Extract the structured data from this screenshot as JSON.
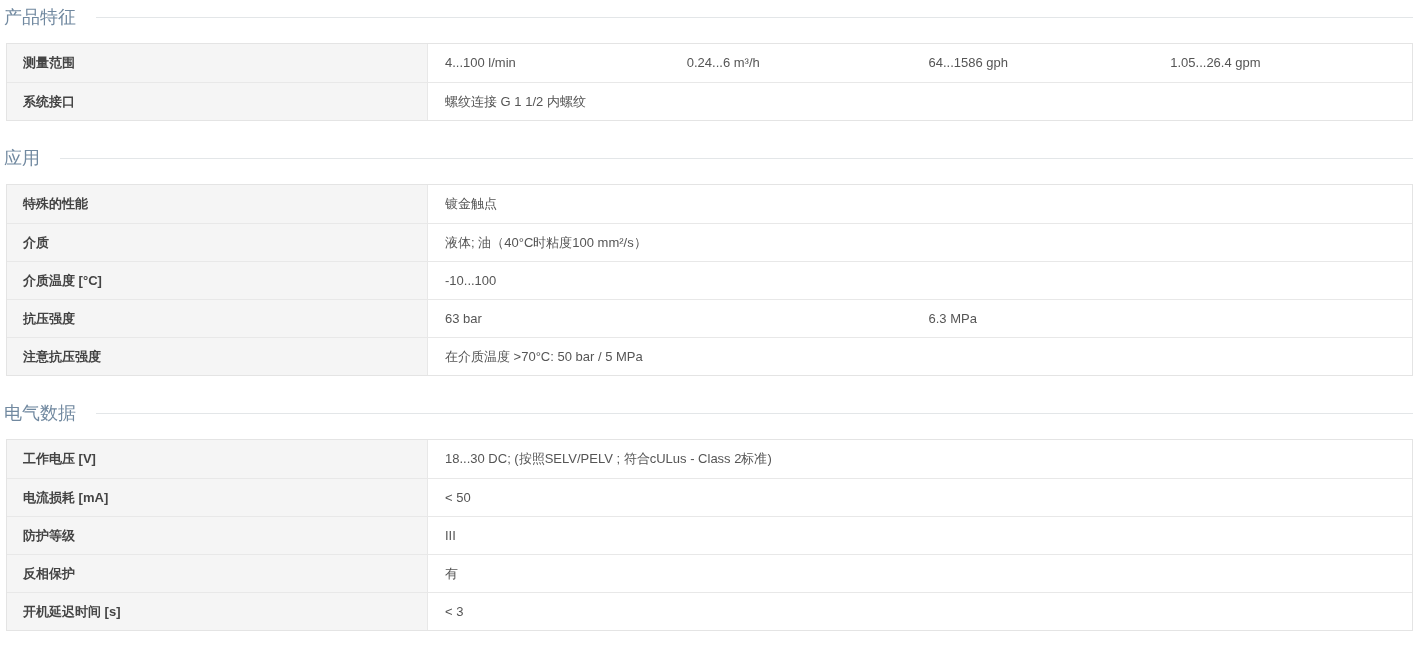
{
  "sections": [
    {
      "title": "产品特征",
      "rows": [
        {
          "label": "测量范围",
          "values": [
            "4...100 l/min",
            "0.24...6 m³/h",
            "64...1586 gph",
            "1.05...26.4 gpm"
          ]
        },
        {
          "label": "系统接口",
          "values": [
            "螺纹连接 G 1 1/2 内螺纹"
          ]
        }
      ]
    },
    {
      "title": "应用",
      "rows": [
        {
          "label": "特殊的性能",
          "values": [
            "镀金触点"
          ]
        },
        {
          "label": "介质",
          "values": [
            "液体; 油（40°C时粘度100 mm²/s）"
          ]
        },
        {
          "label": "介质温度 [°C]",
          "values": [
            "-10...100"
          ]
        },
        {
          "label": "抗压强度",
          "values": [
            "63 bar",
            "6.3 MPa"
          ]
        },
        {
          "label": "注意抗压强度",
          "values": [
            "在介质温度 >70°C: 50 bar / 5 MPa"
          ]
        }
      ]
    },
    {
      "title": "电气数据",
      "rows": [
        {
          "label": "工作电压 [V]",
          "values": [
            "18...30 DC; (按照SELV/PELV ; 符合cULus - Class 2标准)"
          ]
        },
        {
          "label": "电流损耗 [mA]",
          "values": [
            "< 50"
          ]
        },
        {
          "label": "防护等级",
          "values": [
            "III"
          ]
        },
        {
          "label": "反相保护",
          "values": [
            "有"
          ]
        },
        {
          "label": "开机延迟时间 [s]",
          "values": [
            "< 3"
          ]
        }
      ]
    }
  ]
}
